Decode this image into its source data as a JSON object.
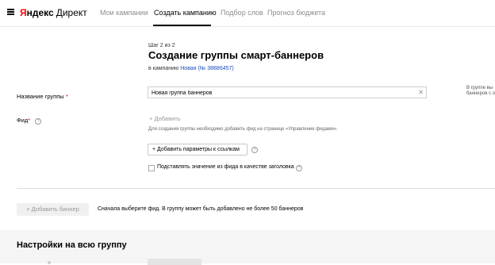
{
  "header": {
    "logo": {
      "ya": "Я",
      "ndex": "ндекс",
      "direct": "Директ"
    },
    "nav": [
      {
        "label": "Мои кампании",
        "active": false
      },
      {
        "label": "Создать кампанию",
        "active": true
      },
      {
        "label": "Подбор слов",
        "active": false
      },
      {
        "label": "Прогноз бюджета",
        "active": false
      }
    ]
  },
  "page": {
    "step": "Шаг 2 из 2",
    "title": "Создание группы смарт-баннеров",
    "campaign_prefix": "в кампанию ",
    "campaign_link": "Новая (№ 38886457)"
  },
  "form": {
    "group_name_label": "Название группы",
    "required_mark": "*",
    "group_name_value": "Новая группа баннеров",
    "side_note": "В группе вы\nбаннеров с о",
    "feed_label": "Фид",
    "add_feed": "+ Добавить",
    "feed_hint": "Для создания группы необходимо добавить фид на странице «Управление фидами».",
    "add_params_button": "+ Добавить параметры к ссылкам",
    "use_feed_title_checkbox": "Подставлять значение из фида в качестве заголовка",
    "use_feed_title_checked": false,
    "help_glyph": "?"
  },
  "banners": {
    "add_banner_button": "+ Добавить баннер",
    "note": "Сначала выберите фид. В группу может быть добавлено не более 50 баннеров"
  },
  "settings": {
    "title": "Настройки на всю группу"
  },
  "icons": {
    "menu": "hamburger-icon",
    "clear": "close-icon",
    "help": "question-circle-icon"
  },
  "colors": {
    "brand_red": "#ff0000",
    "link_blue": "#1a4cbf",
    "required_red": "#dd0000"
  }
}
